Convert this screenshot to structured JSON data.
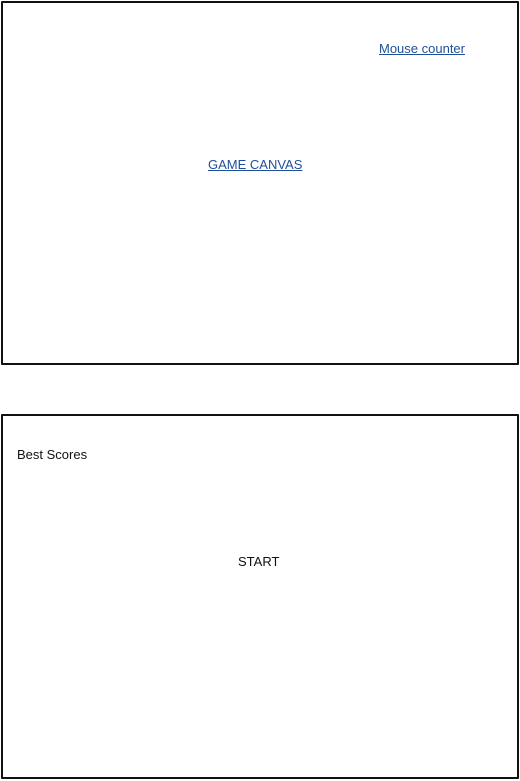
{
  "game_panel": {
    "mouse_counter": "Mouse counter",
    "canvas_label": "GAME CANVAS"
  },
  "menu_panel": {
    "best_scores": "Best Scores",
    "start": "START"
  },
  "colors": {
    "link": "#1f4f9a",
    "border": "#111111",
    "background": "#ffffff"
  }
}
